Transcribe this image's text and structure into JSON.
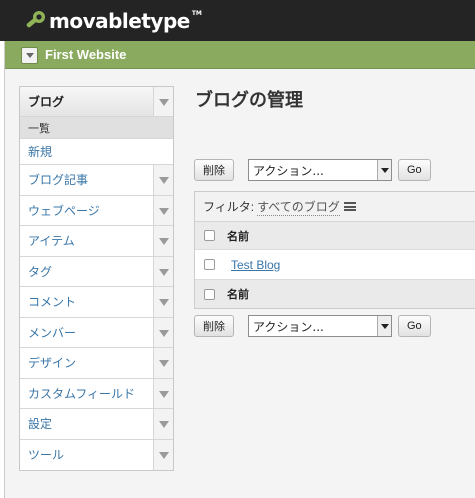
{
  "header": {
    "brand": "movabletype",
    "trademark": "TM"
  },
  "site_bar": {
    "site_name": "First Website"
  },
  "sidebar": {
    "section_title": "ブログ",
    "sub_current": "一覧",
    "sub_link": "新規",
    "items": [
      {
        "label": "ブログ記事"
      },
      {
        "label": "ウェブページ"
      },
      {
        "label": "アイテム"
      },
      {
        "label": "タグ"
      },
      {
        "label": "コメント"
      },
      {
        "label": "メンバー"
      },
      {
        "label": "デザイン"
      },
      {
        "label": "カスタムフィールド"
      },
      {
        "label": "設定"
      },
      {
        "label": "ツール"
      }
    ]
  },
  "main": {
    "title": "ブログの管理",
    "delete_label": "削除",
    "action_select": "アクション...",
    "go_label": "Go",
    "filter_label": "フィルタ:",
    "filter_value": "すべてのブログ",
    "column_name": "名前",
    "rows": [
      {
        "name": "Test Blog"
      }
    ]
  }
}
